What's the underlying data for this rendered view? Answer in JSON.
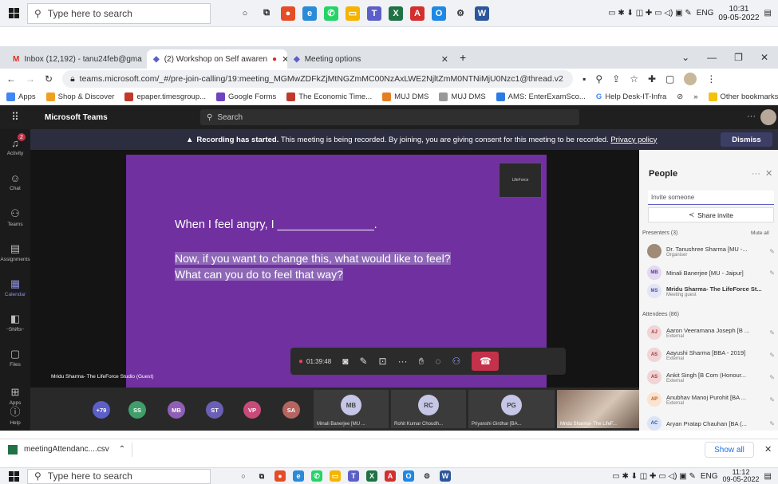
{
  "taskbar_top": {
    "search_placeholder": "Type here to search",
    "lang": "ENG",
    "time": "10:31",
    "date": "09-05-2022"
  },
  "browser": {
    "tabs": [
      {
        "icon": "gmail-icon",
        "label": "Inbox (12,192) - tanu24feb@gma"
      },
      {
        "icon": "teams-icon",
        "label": "(2) Workshop on Self awaren"
      },
      {
        "icon": "teams-icon",
        "label": "Meeting options"
      }
    ],
    "url": "teams.microsoft.com/_#/pre-join-calling/19:meeting_MGMwZDFkZjMtNGZmMC00NzAxLWE2NjltZmM0NTNiMjU0Nzc1@thread.v2",
    "bookmarks": [
      {
        "label": "Apps",
        "color": "#4285f4"
      },
      {
        "label": "Shop & Discover",
        "color": "#f0a020"
      },
      {
        "label": "epaper.timesgroup...",
        "color": "#c0392b"
      },
      {
        "label": "Google Forms",
        "color": "#6f42c1"
      },
      {
        "label": "The Economic Time...",
        "color": "#c0392b"
      },
      {
        "label": "MUJ DMS",
        "color": "#e67e22"
      },
      {
        "label": "MUJ DMS",
        "color": "#999999"
      },
      {
        "label": "AMS: EnterExamSco...",
        "color": "#2c7be5"
      },
      {
        "label": "Help Desk-IT-Infra",
        "color": "#4285f4"
      }
    ],
    "other_bookmarks": "Other bookmarks"
  },
  "teams": {
    "app_name": "Microsoft Teams",
    "search_placeholder": "Search",
    "rail": [
      {
        "label": "Activity",
        "glyph": "♪",
        "badge": "2"
      },
      {
        "label": "Chat",
        "glyph": "☺"
      },
      {
        "label": "Teams",
        "glyph": "⚇"
      },
      {
        "label": "Assignments",
        "glyph": "▤"
      },
      {
        "label": "Calendar",
        "glyph": "▦",
        "selected": true
      },
      {
        "label": "Shifts",
        "glyph": "◧"
      },
      {
        "label": "Files",
        "glyph": "▢"
      },
      {
        "label": "...",
        "glyph": "…"
      }
    ],
    "rail_bottom": [
      {
        "label": "Apps",
        "glyph": "⊞"
      },
      {
        "label": "Help",
        "glyph": "?"
      }
    ],
    "banner": {
      "bold": "Recording has started.",
      "text": " This meeting is being recorded. By joining, you are giving consent for this meeting to be recorded. ",
      "link": "Privacy policy",
      "dismiss": "Dismiss"
    },
    "slide": {
      "line1": "When I feel angry, I _______________.",
      "line2": "Now, if you want to change this, what would like to feel?",
      "line3": "What can you do to feel that way?"
    },
    "presenter_label": "Mridu Sharma- The LifeForce Studio (Guest)",
    "call_timer": "01:39:48",
    "strip_avatars": [
      {
        "initials": "+79",
        "color": "#5b5fc7"
      },
      {
        "initials": "SS",
        "color": "#3f9e6a"
      },
      {
        "initials": "MB",
        "color": "#8e5fb5"
      },
      {
        "initials": "ST",
        "color": "#6a5fb5"
      },
      {
        "initials": "VP",
        "color": "#c94a7a"
      },
      {
        "initials": "SA",
        "color": "#b5645f"
      }
    ],
    "strip_tiles": [
      {
        "initials": "MB",
        "name": "Minali Banerjee [MU ..."
      },
      {
        "initials": "RC",
        "name": "Rohit Kumar Choudh..."
      },
      {
        "initials": "PG",
        "name": "Priyanshi Girdhar [BA..."
      },
      {
        "initials": "",
        "name": "Mridu Sharma- The LifeF..."
      }
    ],
    "people": {
      "title": "People",
      "invite_placeholder": "Invite someone",
      "share_invite": "Share invite",
      "presenters_header": "Presenters (3)",
      "mute_all": "Mute all",
      "presenters": [
        {
          "initials": "",
          "name": "Dr. Tanushree Sharma [MU -...",
          "role": "Organiser"
        },
        {
          "initials": "MB",
          "name": "Minali Banerjee [MU - Jaipur]",
          "role": ""
        },
        {
          "initials": "MS",
          "name": "Mridu Sharma- The LifeForce St...",
          "role": "Meeting guest"
        }
      ],
      "attendees_header": "Attendees (86)",
      "attendees": [
        {
          "initials": "AJ",
          "name": "Aaron Veeramana Joseph [B ...",
          "role": "External"
        },
        {
          "initials": "AS",
          "name": "Aayushi Sharma [BBA - 2019]",
          "role": "External"
        },
        {
          "initials": "AS",
          "name": "Ankit Singh [B Com (Honour...",
          "role": "External"
        },
        {
          "initials": "AP",
          "name": "Anubhav Manoj Purohit [BA ...",
          "role": "External"
        },
        {
          "initials": "AC",
          "name": "Aryan Pratap Chauhan [BA (...",
          "role": ""
        }
      ]
    }
  },
  "downloads": {
    "file": "meetingAttendanc....csv",
    "show_all": "Show all"
  },
  "taskbar_bottom": {
    "search_placeholder": "Type here to search",
    "lang": "ENG",
    "time": "11:12",
    "date": "09-05-2022"
  }
}
